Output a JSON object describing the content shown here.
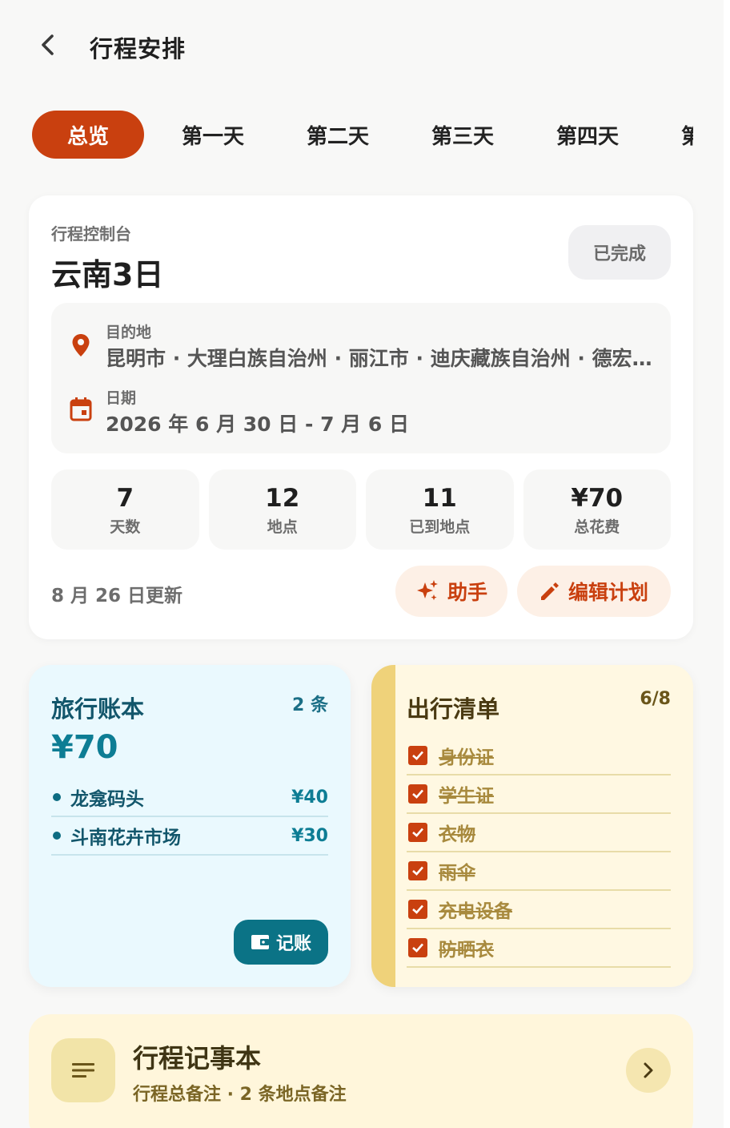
{
  "header": {
    "title": "行程安排",
    "back_icon": "chevron-left-icon"
  },
  "tabs": [
    {
      "label": "总览",
      "active": true
    },
    {
      "label": "第一天"
    },
    {
      "label": "第二天"
    },
    {
      "label": "第三天"
    },
    {
      "label": "第四天"
    },
    {
      "label": "第五天"
    }
  ],
  "console": {
    "label": "行程控制台",
    "title": "云南3日",
    "status": "已完成",
    "destination_label": "目的地",
    "destination_value": "昆明市 · 大理白族自治州 · 丽江市 · 迪庆藏族自治州 · 德宏傣族景颇族自治州",
    "date_label": "日期",
    "date_value": "2026 年 6 月 30 日 - 7 月 6 日",
    "stats": [
      {
        "value": "7",
        "label": "天数"
      },
      {
        "value": "12",
        "label": "地点"
      },
      {
        "value": "11",
        "label": "已到地点"
      },
      {
        "value": "¥70",
        "label": "总花费"
      }
    ],
    "updated": "8 月 26 日更新",
    "assistant_label": "助手",
    "edit_label": "编辑计划"
  },
  "ledger": {
    "title": "旅行账本",
    "count": "2 条",
    "total": "¥70",
    "items": [
      {
        "name": "龙龛码头",
        "amount": "¥40"
      },
      {
        "name": "斗南花卉市场",
        "amount": "¥30"
      }
    ],
    "record_label": "记账"
  },
  "checklist": {
    "title": "出行清单",
    "count": "6/8",
    "items": [
      {
        "label": "身份证",
        "checked": true
      },
      {
        "label": "学生证",
        "checked": true
      },
      {
        "label": "衣物",
        "checked": true
      },
      {
        "label": "雨伞",
        "checked": true
      },
      {
        "label": "充电设备",
        "checked": true
      },
      {
        "label": "防晒衣",
        "checked": true
      }
    ]
  },
  "notes": {
    "title": "行程记事本",
    "subtitle": "行程总备注 · 2 条地点备注"
  },
  "colors": {
    "accent": "#c9400f",
    "ledger_bg": "#eaf9fe",
    "ledger_text": "#12566b",
    "checklist_bg": "#fff8e2",
    "checklist_stripe": "#efd27a"
  }
}
